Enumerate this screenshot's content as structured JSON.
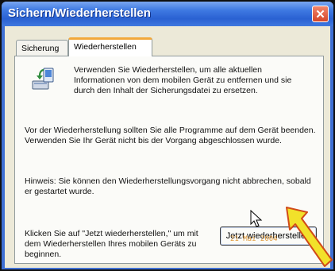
{
  "window": {
    "title": "Sichern/Wiederherstellen",
    "close_icon": "close-icon"
  },
  "tabs": [
    {
      "label": "Sicherung",
      "selected": false
    },
    {
      "label": "Wiederherstellen",
      "selected": true
    }
  ],
  "panel": {
    "intro": "Verwenden Sie Wiederherstellen, um alle aktuellen Informationen von dem mobilen Gerät zu entfernen und sie durch den Inhalt der Sicherungsdatei zu ersetzen.",
    "warning": "Vor der Wiederherstellung sollten Sie alle Programme auf dem Gerät beenden. Verwenden Sie Ihr Gerät nicht bis der Vorgang abgeschlossen wurde.",
    "note": "Hinweis: Sie können den Wiederherstellungsvorgang nicht abbrechen, sobald er gestartet wurde.",
    "instruction": "Klicken Sie auf \"Jetzt wiederherstellen,\" um mit dem Wiederherstellen Ihres mobilen Geräts zu beginnen.",
    "button_label": "Jetzt wiederherstellen"
  },
  "timestamp": "21 Mai 2004",
  "colors": {
    "titlebar": "#3e79e2",
    "client": "#ece9d8",
    "highlight_arrow": "#f2e12a",
    "arrow_outline": "#d14a17",
    "date_stamp": "#e19a3a"
  }
}
